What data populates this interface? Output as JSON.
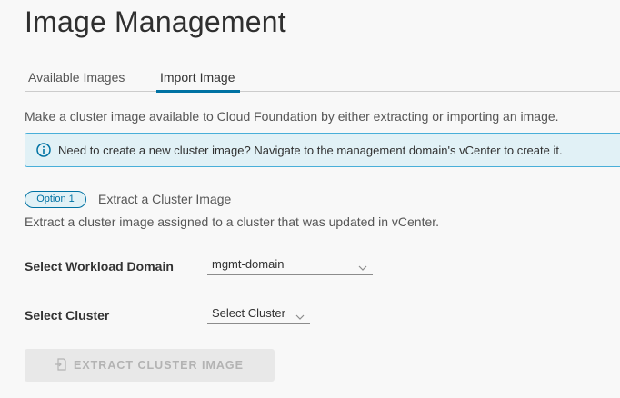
{
  "page": {
    "title": "Image Management"
  },
  "tabs": [
    {
      "label": "Available Images",
      "active": false
    },
    {
      "label": "Import Image",
      "active": true
    }
  ],
  "description": "Make a cluster image available to Cloud Foundation by either extracting or importing an image.",
  "banner": {
    "icon": "info-icon",
    "text": "Need to create a new cluster image? Navigate to the management domain's vCenter to create it."
  },
  "option": {
    "badge": "Option 1",
    "title": "Extract a Cluster Image",
    "description": "Extract a cluster image assigned to a cluster that was updated in vCenter."
  },
  "form": {
    "workload_domain": {
      "label": "Select Workload Domain",
      "value": "mgmt-domain"
    },
    "cluster": {
      "label": "Select Cluster",
      "value": "Select Cluster"
    }
  },
  "actions": {
    "extract_label": "EXTRACT CLUSTER IMAGE",
    "extract_enabled": false,
    "extract_icon": "extract-icon"
  },
  "colors": {
    "accent": "#0072a3",
    "banner_bg": "#e1f1f6",
    "banner_border": "#49afd9",
    "disabled_button_bg": "#e8e8e8",
    "disabled_text": "#b3b3b3"
  }
}
